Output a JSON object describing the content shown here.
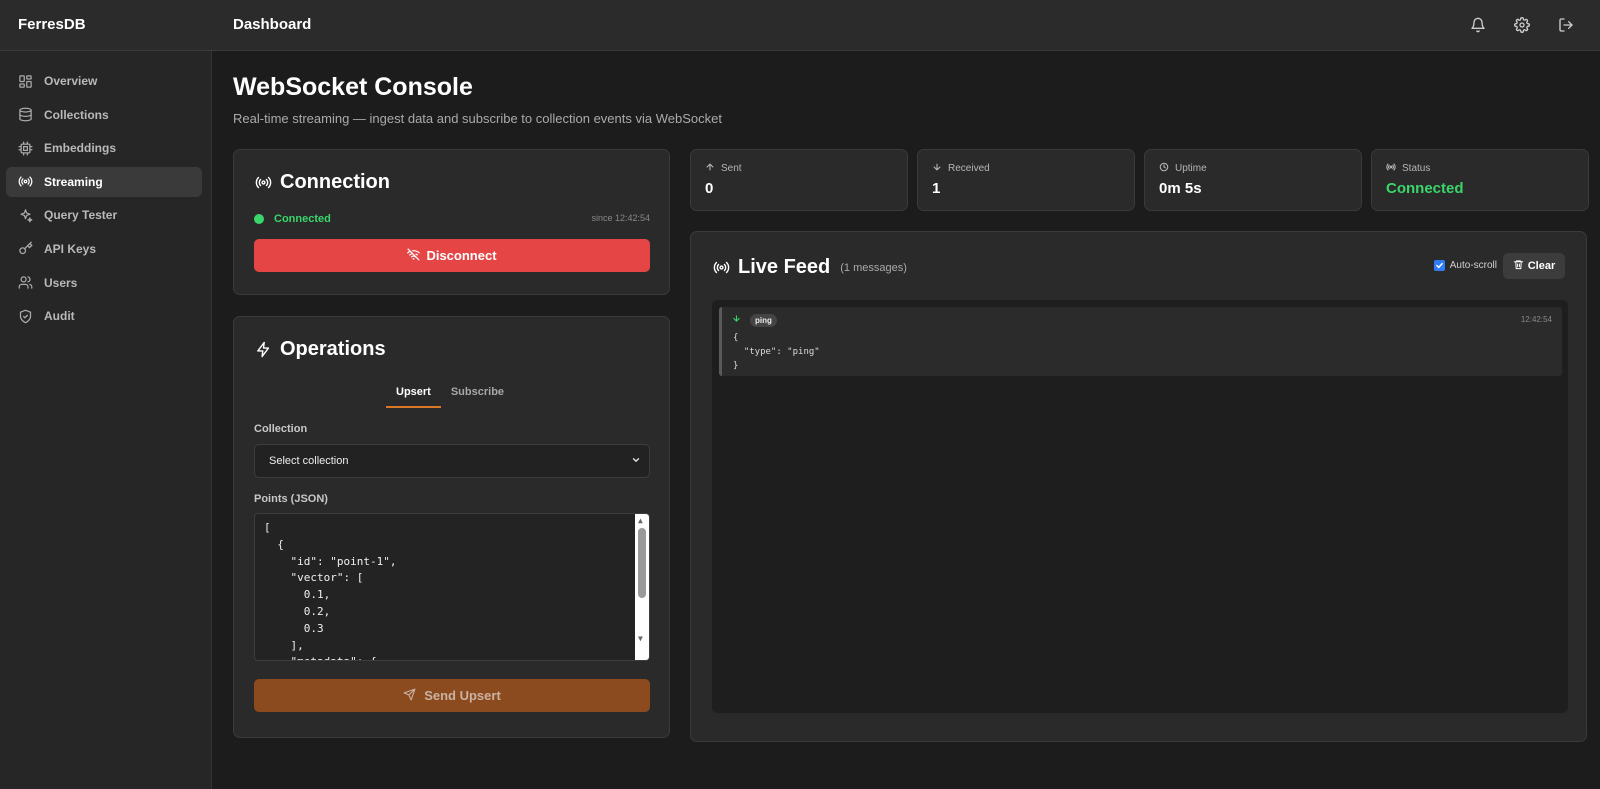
{
  "app": {
    "brand": "FerresDB",
    "breadcrumb": "Dashboard"
  },
  "topbar": {
    "icons": [
      "bell-icon",
      "gear-icon",
      "logout-icon"
    ]
  },
  "sidebar": {
    "items": [
      {
        "label": "Overview",
        "icon": "grid-icon"
      },
      {
        "label": "Collections",
        "icon": "database-icon"
      },
      {
        "label": "Embeddings",
        "icon": "chip-icon"
      },
      {
        "label": "Streaming",
        "icon": "broadcast-icon",
        "active": true
      },
      {
        "label": "Query Tester",
        "icon": "sparkles-icon"
      },
      {
        "label": "API Keys",
        "icon": "key-icon"
      },
      {
        "label": "Users",
        "icon": "users-icon"
      },
      {
        "label": "Audit",
        "icon": "shield-icon"
      }
    ]
  },
  "page": {
    "title": "WebSocket Console",
    "subtitle": "Real-time streaming — ingest data and subscribe to collection events via WebSocket"
  },
  "connection": {
    "title": "Connection",
    "status": "Connected",
    "since": "since 12:42:54",
    "disconnect_label": "Disconnect"
  },
  "operations": {
    "title": "Operations",
    "tabs": [
      {
        "label": "Upsert",
        "active": true
      },
      {
        "label": "Subscribe"
      }
    ],
    "collection_label": "Collection",
    "collection_value": "Select collection",
    "points_label": "Points (JSON)",
    "points_value": "[\n  {\n    \"id\": \"point-1\",\n    \"vector\": [\n      0.1,\n      0.2,\n      0.3\n    ],\n    \"metadata\": {",
    "send_label": "Send Upsert"
  },
  "stats": [
    {
      "label": "Sent",
      "value": "0",
      "icon": "arrow-up-icon"
    },
    {
      "label": "Received",
      "value": "1",
      "icon": "arrow-down-icon"
    },
    {
      "label": "Uptime",
      "value": "0m 5s",
      "icon": "clock-icon"
    },
    {
      "label": "Status",
      "value": "Connected",
      "icon": "broadcast-icon"
    }
  ],
  "feed": {
    "title": "Live Feed",
    "count": "(1 messages)",
    "autoscroll_label": "Auto-scroll",
    "autoscroll_checked": true,
    "clear_label": "Clear",
    "messages": [
      {
        "direction": "received",
        "type": "ping",
        "time": "12:42:54",
        "body": "{\n  \"type\": \"ping\"\n}"
      }
    ]
  },
  "colors": {
    "accent": "#d97826",
    "success": "#3ad56b",
    "danger": "#e64545"
  }
}
